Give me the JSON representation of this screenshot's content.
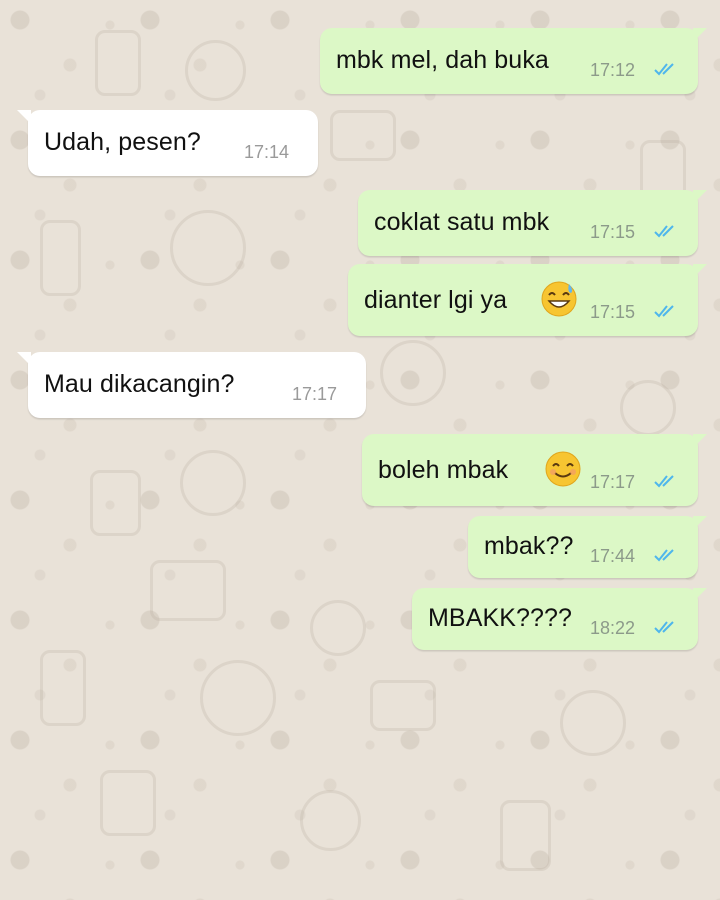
{
  "chat": {
    "messages": [
      {
        "direction": "out",
        "text": "mbk mel, dah buka",
        "time": "17:12",
        "status": "read-ticks-icon"
      },
      {
        "direction": "in",
        "text": "Udah, pesen?",
        "time": "17:14"
      },
      {
        "direction": "out",
        "text": "coklat satu mbk",
        "time": "17:15",
        "status": "read-ticks-icon"
      },
      {
        "direction": "out",
        "text": "dianter lgi ya",
        "time": "17:15",
        "status": "read-ticks-icon",
        "emoji": "grinning-sweat-emoji"
      },
      {
        "direction": "in",
        "text": "Mau dikacangin?",
        "time": "17:17"
      },
      {
        "direction": "out",
        "text": "boleh mbak",
        "time": "17:17",
        "status": "read-ticks-icon",
        "emoji": "smiling-eyes-emoji"
      },
      {
        "direction": "out",
        "text": "mbak??",
        "time": "17:44",
        "status": "read-ticks-icon"
      },
      {
        "direction": "out",
        "text": "MBAKK????",
        "time": "18:22",
        "status": "read-ticks-icon"
      }
    ]
  },
  "colors": {
    "wallpaper": "#e9e2d8",
    "incoming_bubble": "#ffffff",
    "outgoing_bubble": "#dcf8c6",
    "read_ticks": "#4fb6ec",
    "timestamp": "#8c9a8a"
  }
}
